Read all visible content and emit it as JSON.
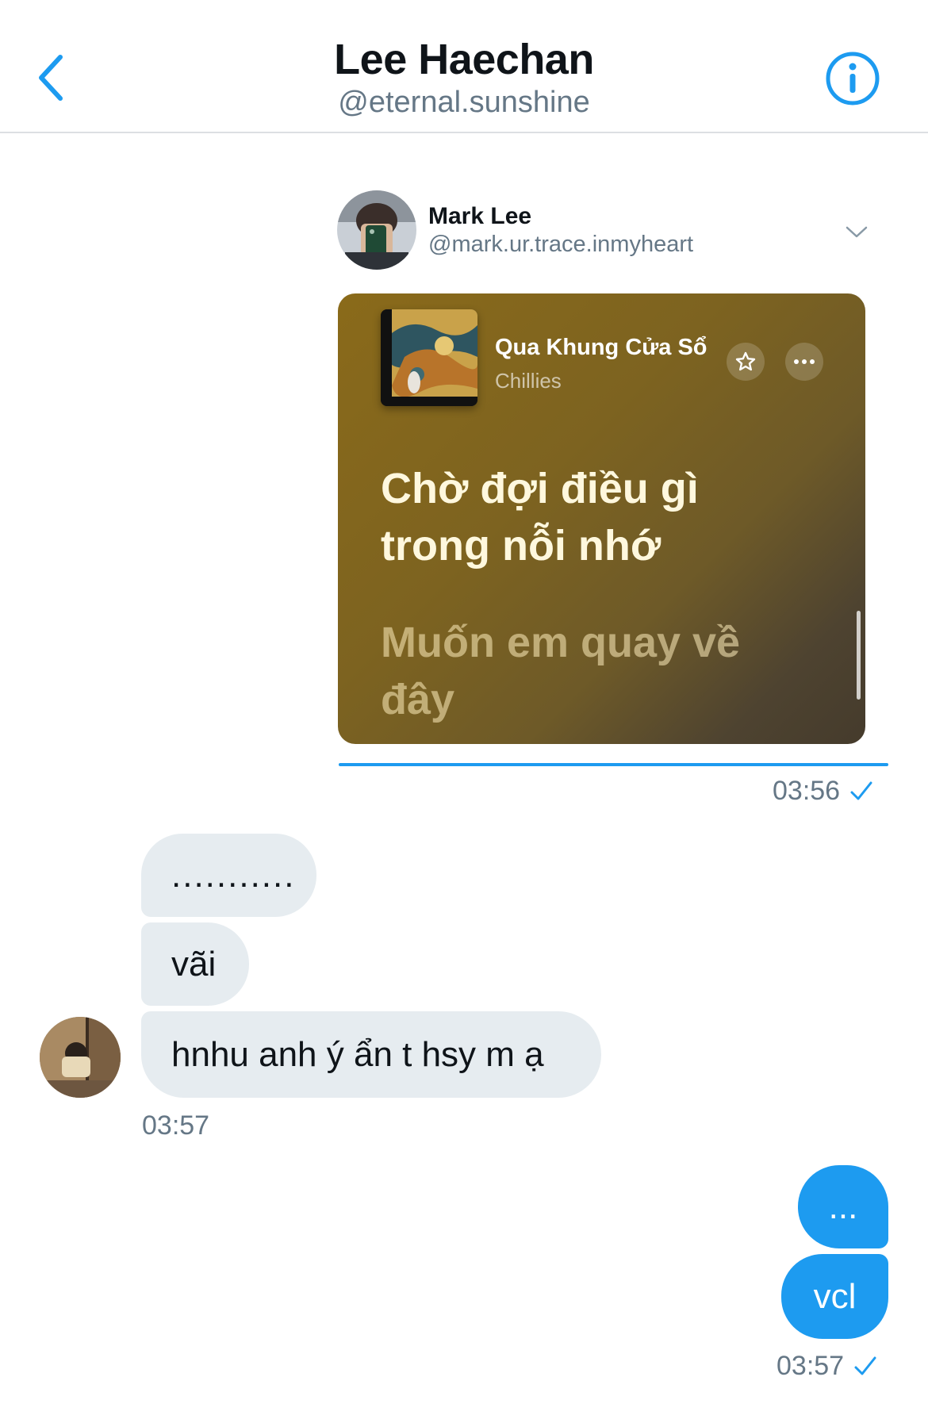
{
  "header": {
    "title": "Lee Haechan",
    "handle": "@eternal.sunshine",
    "back_icon": "chevron-left-icon",
    "info_icon": "info-icon",
    "accent": "#1d9bf0"
  },
  "shared_post": {
    "author_name": "Mark Lee",
    "author_handle": "@mark.ur.trace.inmyheart",
    "music": {
      "song_title": "Qua Khung Cửa Sổ",
      "artist": "Chillies",
      "lyric_current": "Chờ đợi điều gì trong nỗi nhớ",
      "lyric_next": "Muốn em quay về đây"
    },
    "time": "03:56"
  },
  "received": {
    "messages": [
      "...........",
      "vãi",
      "hnhu anh ý ẩn t hsy m ạ"
    ],
    "time": "03:57"
  },
  "sent": {
    "messages": [
      "...",
      "vcl"
    ],
    "time": "03:57"
  }
}
